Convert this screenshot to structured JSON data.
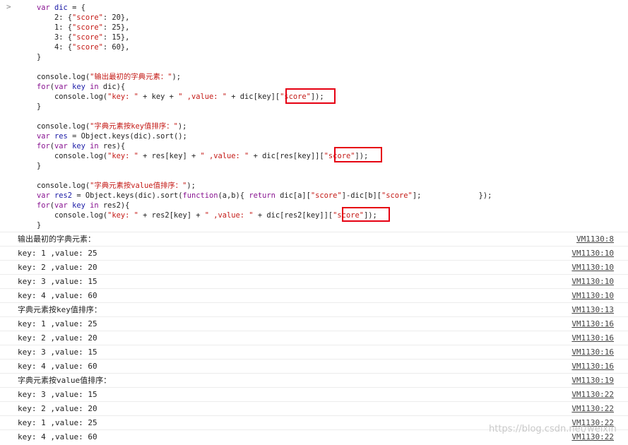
{
  "console": {
    "prompt_glyph": ">",
    "code_lines": [
      [
        {
          "t": "var ",
          "c": "kw"
        },
        {
          "t": "dic",
          "c": "id"
        },
        {
          "t": " = {"
        }
      ],
      [
        {
          "t": "    2: {"
        },
        {
          "t": "\"score\"",
          "c": "str"
        },
        {
          "t": ": 20},"
        }
      ],
      [
        {
          "t": "    1: {"
        },
        {
          "t": "\"score\"",
          "c": "str"
        },
        {
          "t": ": 25},"
        }
      ],
      [
        {
          "t": "    3: {"
        },
        {
          "t": "\"score\"",
          "c": "str"
        },
        {
          "t": ": 15},"
        }
      ],
      [
        {
          "t": "    4: {"
        },
        {
          "t": "\"score\"",
          "c": "str"
        },
        {
          "t": ": 60},"
        }
      ],
      [
        {
          "t": "}"
        }
      ],
      [
        {
          "t": ""
        }
      ],
      [
        {
          "t": "console.log("
        },
        {
          "t": "\"输出最初的字典元素：\"",
          "c": "str"
        },
        {
          "t": ");"
        }
      ],
      [
        {
          "t": "for",
          "c": "kw"
        },
        {
          "t": "("
        },
        {
          "t": "var ",
          "c": "kw"
        },
        {
          "t": "key",
          "c": "id"
        },
        {
          "t": " in ",
          "c": "kw"
        },
        {
          "t": "dic){"
        }
      ],
      [
        {
          "t": "    console.log("
        },
        {
          "t": "\"key: \"",
          "c": "str"
        },
        {
          "t": " + key + "
        },
        {
          "t": "\" ,value: \"",
          "c": "str"
        },
        {
          "t": " + dic[key]["
        },
        {
          "t": "\"score\"",
          "c": "str"
        },
        {
          "t": "]);"
        }
      ],
      [
        {
          "t": "}"
        }
      ],
      [
        {
          "t": ""
        }
      ],
      [
        {
          "t": "console.log("
        },
        {
          "t": "\"字典元素按key值排序：\"",
          "c": "str"
        },
        {
          "t": ");"
        }
      ],
      [
        {
          "t": "var ",
          "c": "kw"
        },
        {
          "t": "res",
          "c": "id"
        },
        {
          "t": " = Object.keys(dic).sort();"
        }
      ],
      [
        {
          "t": "for",
          "c": "kw"
        },
        {
          "t": "("
        },
        {
          "t": "var ",
          "c": "kw"
        },
        {
          "t": "key",
          "c": "id"
        },
        {
          "t": " in ",
          "c": "kw"
        },
        {
          "t": "res){"
        }
      ],
      [
        {
          "t": "    console.log("
        },
        {
          "t": "\"key: \"",
          "c": "str"
        },
        {
          "t": " + res[key] + "
        },
        {
          "t": "\" ,value: \"",
          "c": "str"
        },
        {
          "t": " + dic[res[key]]["
        },
        {
          "t": "\"score\"",
          "c": "str"
        },
        {
          "t": "]);"
        }
      ],
      [
        {
          "t": "}"
        }
      ],
      [
        {
          "t": ""
        }
      ],
      [
        {
          "t": "console.log("
        },
        {
          "t": "\"字典元素按value值排序：\"",
          "c": "str"
        },
        {
          "t": ");"
        }
      ],
      [
        {
          "t": "var ",
          "c": "kw"
        },
        {
          "t": "res2",
          "c": "id"
        },
        {
          "t": " = Object.keys(dic).sort("
        },
        {
          "t": "function",
          "c": "kw"
        },
        {
          "t": "(a,b){ "
        },
        {
          "t": "return ",
          "c": "kw"
        },
        {
          "t": "dic[a]["
        },
        {
          "t": "\"score\"",
          "c": "str"
        },
        {
          "t": "]-dic[b]["
        },
        {
          "t": "\"score\"",
          "c": "str"
        },
        {
          "t": "];             });"
        }
      ],
      [
        {
          "t": "for",
          "c": "kw"
        },
        {
          "t": "("
        },
        {
          "t": "var ",
          "c": "kw"
        },
        {
          "t": "key",
          "c": "id"
        },
        {
          "t": " in ",
          "c": "kw"
        },
        {
          "t": "res2){"
        }
      ],
      [
        {
          "t": "    console.log("
        },
        {
          "t": "\"key: \"",
          "c": "str"
        },
        {
          "t": " + res2[key] + "
        },
        {
          "t": "\" ,value: \"",
          "c": "str"
        },
        {
          "t": " + dic[res2[key]]["
        },
        {
          "t": "\"score\"",
          "c": "str"
        },
        {
          "t": "]);"
        }
      ],
      [
        {
          "t": "}"
        }
      ]
    ],
    "output": [
      {
        "msg": "输出最初的字典元素：",
        "src": "VM1130:8"
      },
      {
        "msg": "key: 1 ,value: 25",
        "src": "VM1130:10"
      },
      {
        "msg": "key: 2 ,value: 20",
        "src": "VM1130:10"
      },
      {
        "msg": "key: 3 ,value: 15",
        "src": "VM1130:10"
      },
      {
        "msg": "key: 4 ,value: 60",
        "src": "VM1130:10"
      },
      {
        "msg": "字典元素按key值排序：",
        "src": "VM1130:13"
      },
      {
        "msg": "key: 1 ,value: 25",
        "src": "VM1130:16"
      },
      {
        "msg": "key: 2 ,value: 20",
        "src": "VM1130:16"
      },
      {
        "msg": "key: 3 ,value: 15",
        "src": "VM1130:16"
      },
      {
        "msg": "key: 4 ,value: 60",
        "src": "VM1130:16"
      },
      {
        "msg": "字典元素按value值排序：",
        "src": "VM1130:19"
      },
      {
        "msg": "key: 3 ,value: 15",
        "src": "VM1130:22"
      },
      {
        "msg": "key: 2 ,value: 20",
        "src": "VM1130:22"
      },
      {
        "msg": "key: 1 ,value: 25",
        "src": "VM1130:22"
      },
      {
        "msg": "key: 4 ,value: 60",
        "src": "VM1130:22"
      }
    ],
    "colors": {
      "keyword": "#881391",
      "string": "#c41a16",
      "identifier": "#1a1aa6",
      "highlight_box": "#e60012"
    }
  },
  "watermark": "https://blog.csdn.net/weixin"
}
